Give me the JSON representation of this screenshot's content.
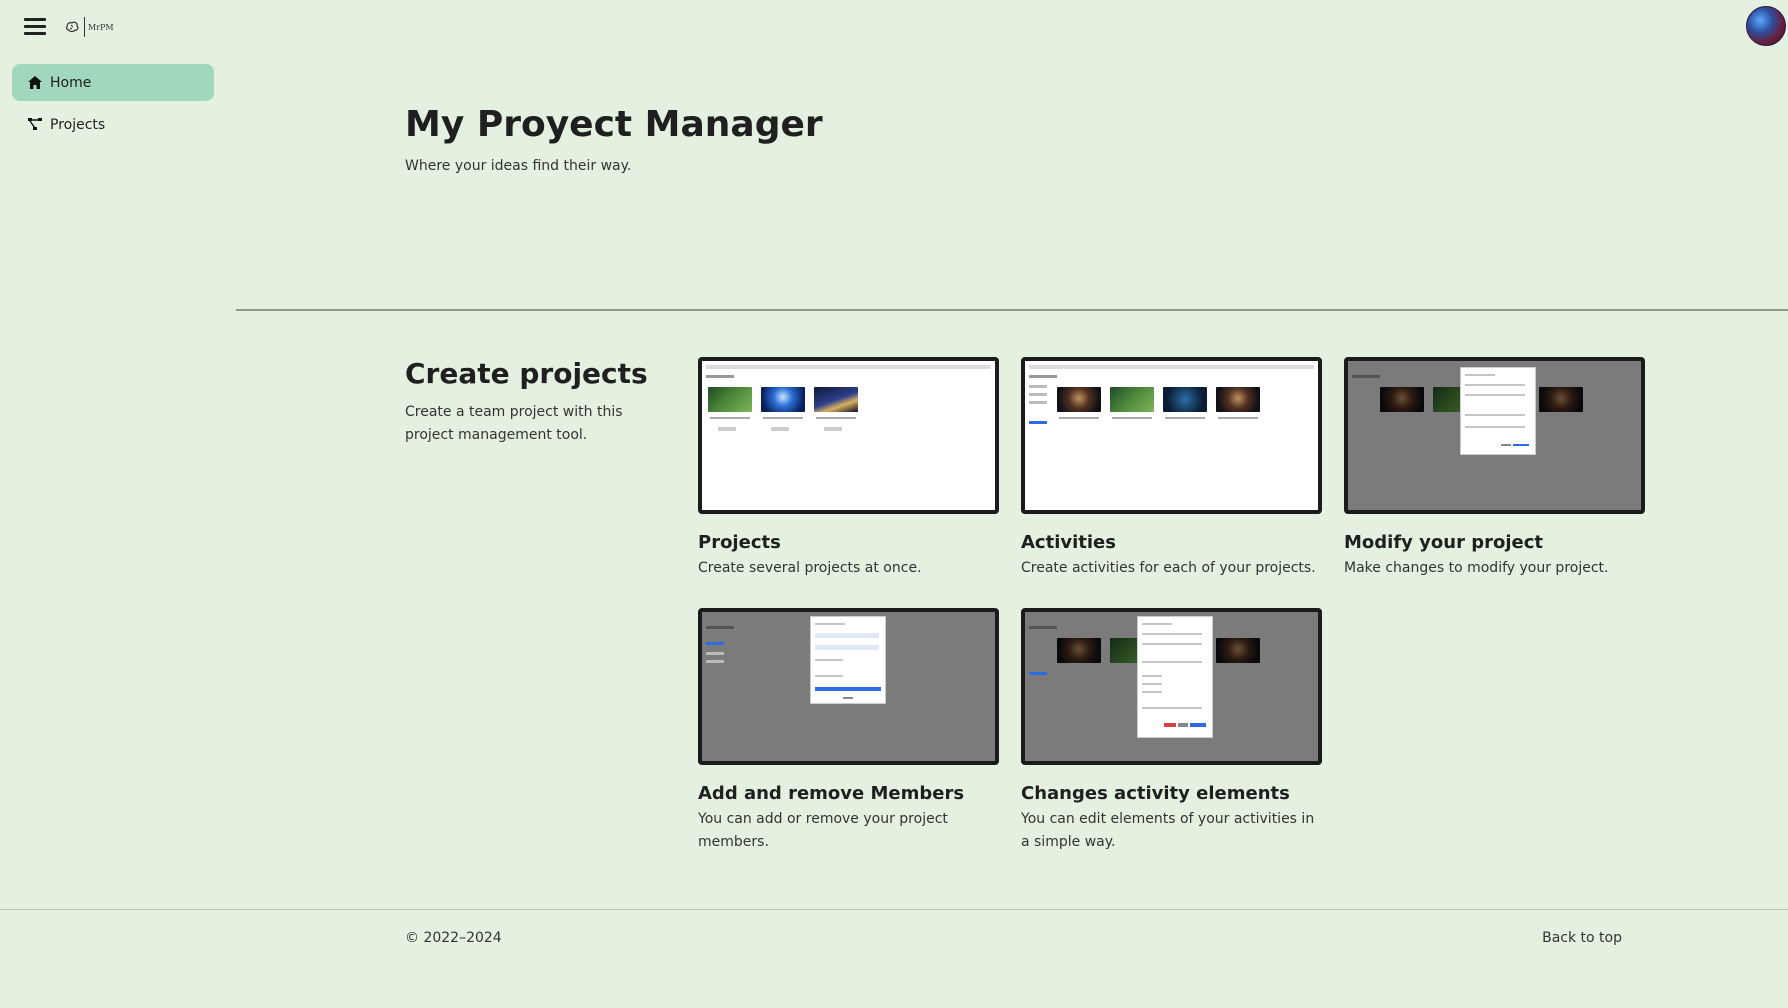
{
  "topbar": {
    "logo_text": "MrPM"
  },
  "sidebar": {
    "items": [
      {
        "label": "Home",
        "icon": "home-icon",
        "active": true
      },
      {
        "label": "Projects",
        "icon": "project-diagram-icon",
        "active": false
      }
    ]
  },
  "hero": {
    "title": "My Proyect Manager",
    "subtitle": "Where your ideas find their way."
  },
  "section": {
    "title": "Create projects",
    "description": "Create a team project with this project management tool."
  },
  "cards": [
    {
      "title": "Projects",
      "description": "Create several projects at once."
    },
    {
      "title": "Activities",
      "description": "Create activities for each of your projects."
    },
    {
      "title": "Modify your project",
      "description": "Make changes to modify your project."
    },
    {
      "title": "Add and remove Members",
      "description": "You can add or remove your project members."
    },
    {
      "title": "Changes activity elements",
      "description": "You can edit elements of your activities in a simple way."
    }
  ],
  "footer": {
    "copyright": "© 2022–2024",
    "back_to_top": "Back to top"
  },
  "colors": {
    "background": "#e4f0e0",
    "active_nav": "#a1d7bd",
    "thumbnail_border": "#1b1b1b"
  }
}
